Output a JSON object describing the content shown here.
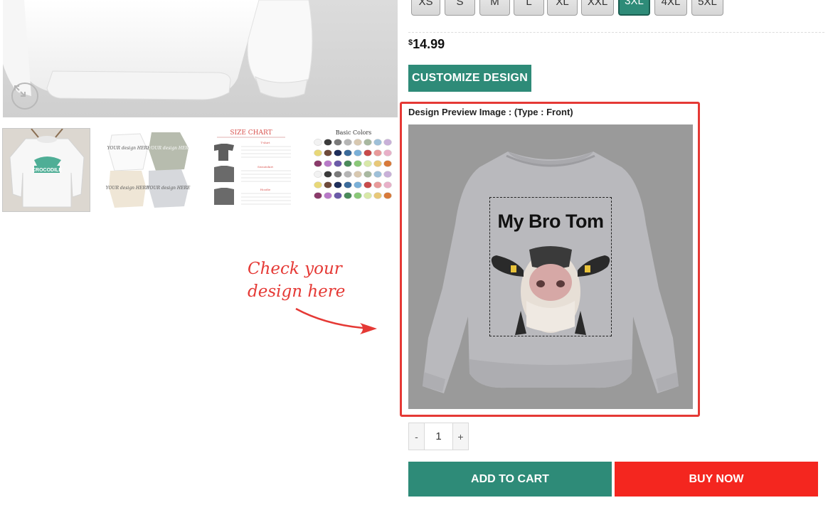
{
  "sizes": {
    "options": [
      "XS",
      "S",
      "M",
      "L",
      "XL",
      "XXL",
      "3XL",
      "4XL",
      "5XL"
    ],
    "selected": "3XL"
  },
  "price": {
    "currency": "$",
    "amount": "14.99"
  },
  "customize_button": "CUSTOMIZE DESIGN",
  "preview": {
    "label": "Design Preview Image : (Type : Front)",
    "design_text": "My Bro Tom"
  },
  "annotation": {
    "text_line1": "Check your",
    "text_line2": "design here"
  },
  "thumbnails": {
    "crocodile_text": "CROCODILE",
    "mockup_text": "YOUR design HERE",
    "size_chart_title": "SIZE CHART",
    "size_chart_sections": [
      "T-shirt",
      "Sweatshirt",
      "Hoodie"
    ],
    "colors_title": "Basic Colors"
  },
  "quantity": {
    "minus": "-",
    "value": "1",
    "plus": "+"
  },
  "add_to_cart": "ADD TO CART",
  "buy_now": "BUY NOW",
  "colors": {
    "accent": "#2e8b78",
    "buy": "#f4261f",
    "highlight": "#e53935"
  }
}
